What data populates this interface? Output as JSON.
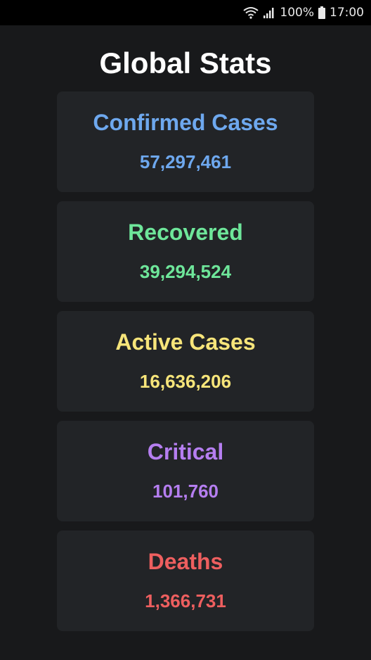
{
  "status_bar": {
    "battery": "100%",
    "time": "17:00"
  },
  "page": {
    "title": "Global Stats"
  },
  "stats": [
    {
      "label": "Confirmed Cases",
      "value": "57,297,461",
      "color": "#6ea8ee"
    },
    {
      "label": "Recovered",
      "value": "39,294,524",
      "color": "#6ee69a"
    },
    {
      "label": "Active Cases",
      "value": "16,636,206",
      "color": "#f7e57a"
    },
    {
      "label": "Critical",
      "value": "101,760",
      "color": "#b57ef0"
    },
    {
      "label": "Deaths",
      "value": "1,366,731",
      "color": "#ee5f5f"
    }
  ]
}
